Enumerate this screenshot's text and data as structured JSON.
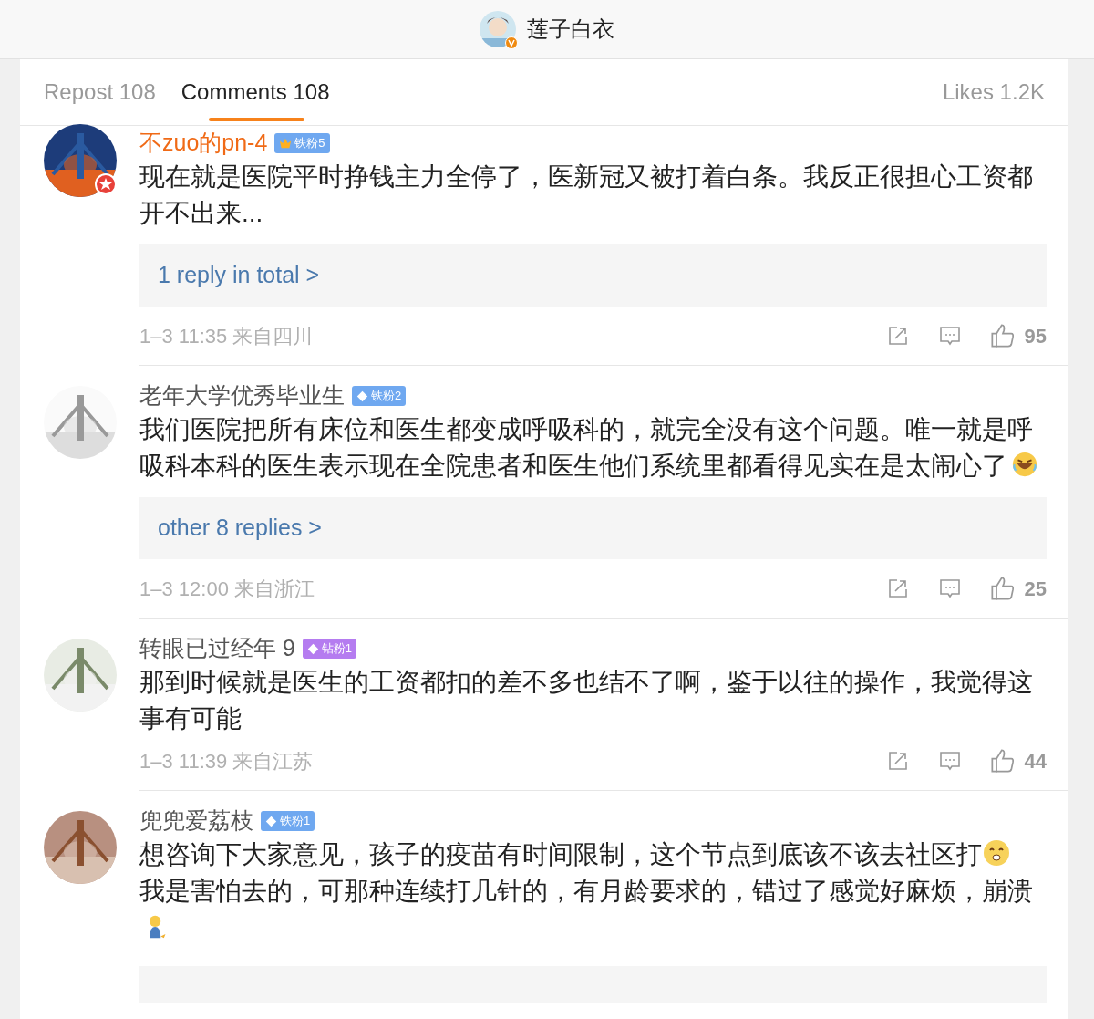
{
  "header": {
    "title": "莲子白衣"
  },
  "tabs": [
    {
      "label": "Repost 108",
      "selected": false
    },
    {
      "label": "Comments 108",
      "selected": true
    }
  ],
  "likes_total": "Likes 1.2K",
  "comments": [
    {
      "name": "不zuo的pn-4",
      "name_highlight": true,
      "avatar_badge": true,
      "badge": {
        "label": "铁粉5",
        "color": "#6fa8f0",
        "kind": "crown"
      },
      "text": "现在就是医院平时挣钱主力全停了，医新冠又被打着白条。我反正很担心工资都开不出来...",
      "replies": "1 reply in total >",
      "time": "1–3 11:35 来自四川",
      "likes": "95"
    },
    {
      "name": "老年大学优秀毕业生",
      "name_highlight": false,
      "avatar_badge": false,
      "badge": {
        "label": "铁粉2",
        "color": "#6fa8f0",
        "kind": "diamond"
      },
      "text": "我们医院把所有床位和医生都变成呼吸科的，就完全没有这个问题。唯一就是呼吸科本科的医生表示现在全院患者和医生他们系统里都看得见实在是太闹心了",
      "emoji": {
        "kind": "laugh"
      },
      "replies": "other 8 replies >",
      "time": "1–3 12:00 来自浙江",
      "likes": "25"
    },
    {
      "name": "转眼已过经年 9",
      "name_highlight": false,
      "avatar_badge": false,
      "badge": {
        "label": "钻粉1",
        "color": "#b57cf0",
        "kind": "diamond"
      },
      "text": "那到时候就是医生的工资都扣的差不多也结不了啊，鉴于以往的操作，我觉得这事有可能",
      "time": "1–3 11:39 来自江苏",
      "likes": "44"
    },
    {
      "name": "兜兜爱荔枝",
      "name_highlight": false,
      "avatar_badge": false,
      "badge": {
        "label": "铁粉1",
        "color": "#6fa8f0",
        "kind": "diamond"
      },
      "text": "想咨询下大家意见，孩子的疫苗有时间限制，这个节点到底该不该去社区打",
      "emoji": {
        "kind": "smile"
      },
      "text2": "我是害怕去的，可那种连续打几针的，有月龄要求的，错过了感觉好麻烦，崩溃",
      "emoji2": {
        "kind": "figure"
      },
      "more_replies_box": true
    }
  ]
}
